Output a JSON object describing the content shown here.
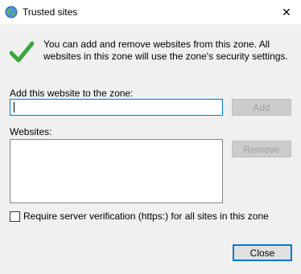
{
  "window": {
    "title": "Trusted sites",
    "close_glyph": "✕",
    "accent_color": "#0078d7"
  },
  "info": {
    "icon": "checkmark-icon",
    "text": "You can add and remove websites from this zone. All websites in this zone will use the zone's security settings."
  },
  "add_site": {
    "label": "Add this website to the zone:",
    "value": "",
    "button_label": "Add",
    "button_enabled": false
  },
  "websites": {
    "label": "Websites:",
    "items": [],
    "remove_label": "Remove",
    "remove_enabled": false
  },
  "https_option": {
    "label": "Require server verification (https:) for all sites in this zone",
    "checked": false
  },
  "footer": {
    "close_label": "Close"
  }
}
